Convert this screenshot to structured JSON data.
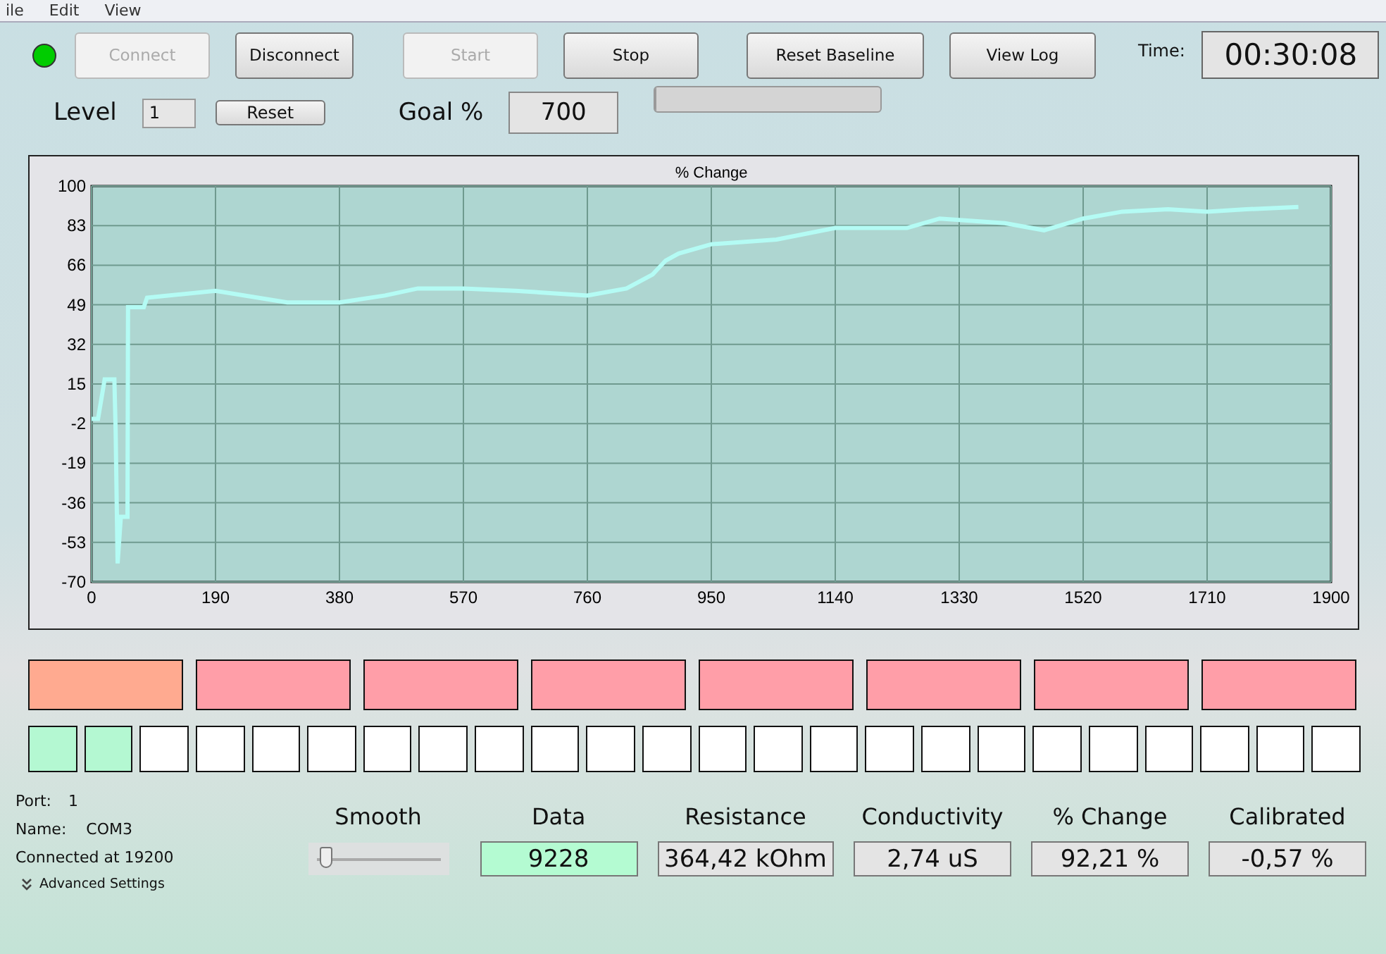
{
  "menu": [
    "ile",
    "Edit",
    "View"
  ],
  "status_led": {
    "color": "#00cc00"
  },
  "buttons": [
    {
      "label": "Connect",
      "disabled": true
    },
    {
      "label": "Disconnect",
      "disabled": false
    },
    {
      "label": "Start",
      "disabled": true
    },
    {
      "label": "Stop",
      "disabled": false
    },
    {
      "label": "Reset Baseline",
      "disabled": false
    },
    {
      "label": "View Log",
      "disabled": false
    }
  ],
  "time": {
    "label": "Time:",
    "value": "00:30:08"
  },
  "level": {
    "label": "Level",
    "value": "1",
    "reset": "Reset"
  },
  "goal": {
    "label": "Goal %",
    "value": "700"
  },
  "progress": {
    "level": 0
  },
  "chart": {
    "chart_data": {
      "type": "line",
      "title": "% Change",
      "x": [
        0,
        10,
        20,
        35,
        37,
        40,
        45,
        55,
        56,
        80,
        85,
        190,
        300,
        380,
        450,
        500,
        570,
        650,
        760,
        820,
        860,
        880,
        900,
        950,
        1050,
        1140,
        1250,
        1300,
        1400,
        1460,
        1520,
        1580,
        1650,
        1710,
        1770,
        1850
      ],
      "grid": true,
      "series": [
        {
          "color": "#b4fbf4",
          "values": [
            0,
            0,
            17,
            17,
            -5,
            -62,
            -42,
            -42,
            48,
            48,
            52,
            55,
            50,
            50,
            53,
            56,
            56,
            55,
            53,
            56,
            62,
            68,
            71,
            75,
            77,
            82,
            82,
            86,
            84,
            81,
            86,
            89,
            90,
            89,
            90,
            91
          ]
        }
      ],
      "xlim": [
        0,
        1900
      ],
      "ylim": [
        -70,
        100
      ],
      "xticks": [
        0,
        190,
        380,
        570,
        760,
        950,
        1140,
        1330,
        1520,
        1710,
        1900
      ],
      "yticks": [
        100,
        83,
        66,
        49,
        32,
        15,
        -2,
        -19,
        -36,
        -53,
        -70
      ]
    }
  },
  "zones": [
    {
      "color": "#ffaa90"
    },
    {
      "color": "#ff9ea8"
    },
    {
      "color": "#ff9ea8"
    },
    {
      "color": "#ff9ea8"
    },
    {
      "color": "#ff9ea8"
    },
    {
      "color": "#ff9ea8"
    },
    {
      "color": "#ff9ea8"
    },
    {
      "color": "#ff9ea8"
    }
  ],
  "cells": [
    {
      "on": true
    },
    {
      "on": true
    },
    {
      "on": false
    },
    {
      "on": false
    },
    {
      "on": false
    },
    {
      "on": false
    },
    {
      "on": false
    },
    {
      "on": false
    },
    {
      "on": false
    },
    {
      "on": false
    },
    {
      "on": false
    },
    {
      "on": false
    },
    {
      "on": false
    },
    {
      "on": false
    },
    {
      "on": false
    },
    {
      "on": false
    },
    {
      "on": false
    },
    {
      "on": false
    },
    {
      "on": false
    },
    {
      "on": false
    },
    {
      "on": false
    },
    {
      "on": false
    },
    {
      "on": false
    },
    {
      "on": false
    }
  ],
  "connection": {
    "port_label": "Port:",
    "port": "1",
    "name_label": "Name:",
    "name": "COM3",
    "status": "Connected at 19200",
    "advanced": "Advanced Settings"
  },
  "smooth": {
    "label": "Smooth",
    "level": 0.05
  },
  "readouts": [
    {
      "label": "Data",
      "value": "9228",
      "highlight": true
    },
    {
      "label": "Resistance",
      "value": "364,42 kOhm",
      "highlight": false
    },
    {
      "label": "Conductivity",
      "value": "2,74 uS",
      "highlight": false
    },
    {
      "label": "% Change",
      "value": "92,21 %",
      "highlight": false
    },
    {
      "label": "Calibrated",
      "value": "-0,57 %",
      "highlight": false
    }
  ]
}
